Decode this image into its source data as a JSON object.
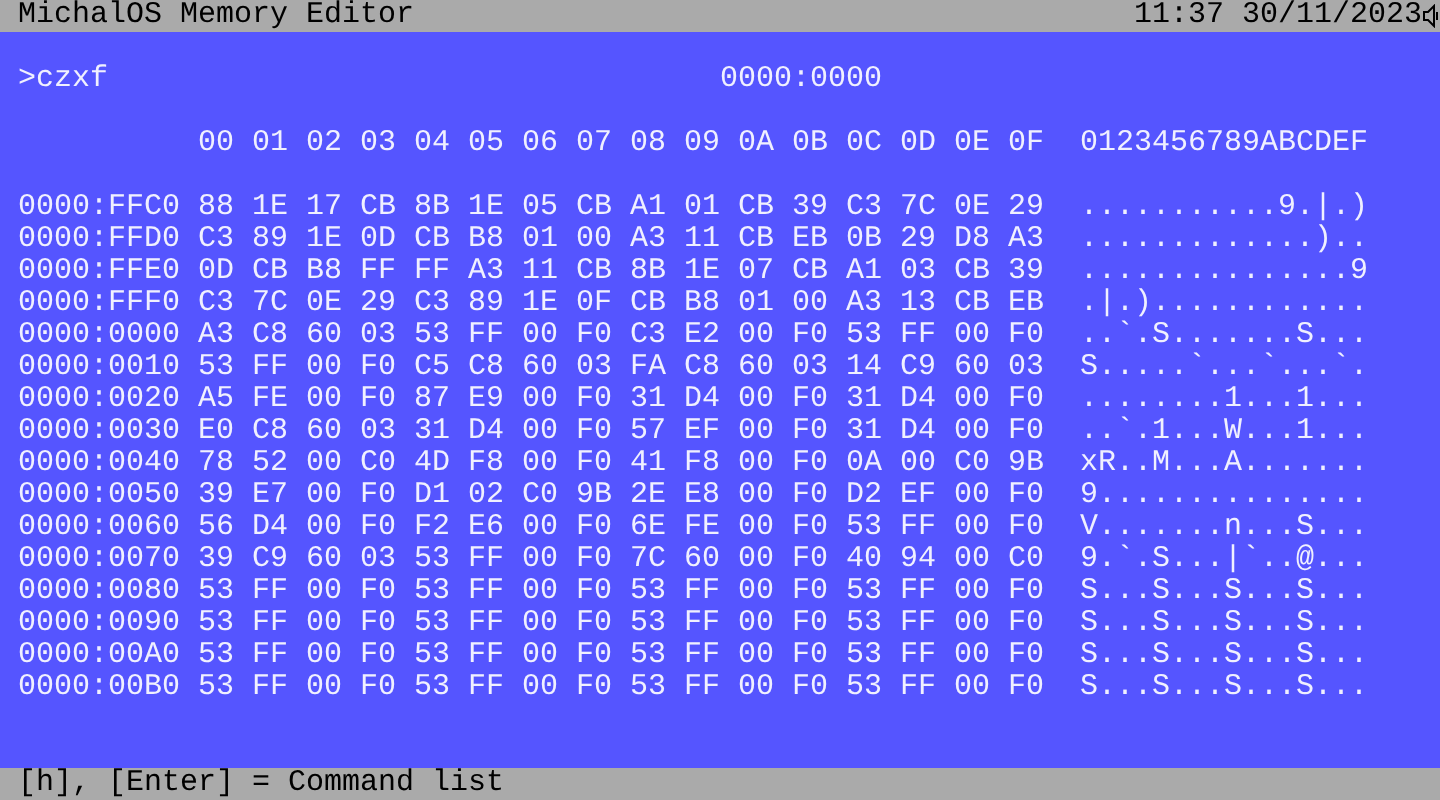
{
  "title_bar": {
    "title": "MichalOS Memory Editor",
    "clock": "11:37 30/11/2023"
  },
  "command": ">czxf",
  "address": "0000:0000",
  "column_headers": [
    "00",
    "01",
    "02",
    "03",
    "04",
    "05",
    "06",
    "07",
    "08",
    "09",
    "0A",
    "0B",
    "0C",
    "0D",
    "0E",
    "0F"
  ],
  "ascii_header": "0123456789ABCDEF",
  "rows": [
    {
      "address": "0000:FFC0",
      "bytes": [
        "88",
        "1E",
        "17",
        "CB",
        "8B",
        "1E",
        "05",
        "CB",
        "A1",
        "01",
        "CB",
        "39",
        "C3",
        "7C",
        "0E",
        "29"
      ],
      "ascii": "...........9.|.)"
    },
    {
      "address": "0000:FFD0",
      "bytes": [
        "C3",
        "89",
        "1E",
        "0D",
        "CB",
        "B8",
        "01",
        "00",
        "A3",
        "11",
        "CB",
        "EB",
        "0B",
        "29",
        "D8",
        "A3"
      ],
      "ascii": ".............).."
    },
    {
      "address": "0000:FFE0",
      "bytes": [
        "0D",
        "CB",
        "B8",
        "FF",
        "FF",
        "A3",
        "11",
        "CB",
        "8B",
        "1E",
        "07",
        "CB",
        "A1",
        "03",
        "CB",
        "39"
      ],
      "ascii": "...............9"
    },
    {
      "address": "0000:FFF0",
      "bytes": [
        "C3",
        "7C",
        "0E",
        "29",
        "C3",
        "89",
        "1E",
        "0F",
        "CB",
        "B8",
        "01",
        "00",
        "A3",
        "13",
        "CB",
        "EB"
      ],
      "ascii": ".|.)............"
    },
    {
      "address": "0000:0000",
      "bytes": [
        "A3",
        "C8",
        "60",
        "03",
        "53",
        "FF",
        "00",
        "F0",
        "C3",
        "E2",
        "00",
        "F0",
        "53",
        "FF",
        "00",
        "F0"
      ],
      "ascii": "..`.S.......S..."
    },
    {
      "address": "0000:0010",
      "bytes": [
        "53",
        "FF",
        "00",
        "F0",
        "C5",
        "C8",
        "60",
        "03",
        "FA",
        "C8",
        "60",
        "03",
        "14",
        "C9",
        "60",
        "03"
      ],
      "ascii": "S.....`...`...`."
    },
    {
      "address": "0000:0020",
      "bytes": [
        "A5",
        "FE",
        "00",
        "F0",
        "87",
        "E9",
        "00",
        "F0",
        "31",
        "D4",
        "00",
        "F0",
        "31",
        "D4",
        "00",
        "F0"
      ],
      "ascii": "........1...1..."
    },
    {
      "address": "0000:0030",
      "bytes": [
        "E0",
        "C8",
        "60",
        "03",
        "31",
        "D4",
        "00",
        "F0",
        "57",
        "EF",
        "00",
        "F0",
        "31",
        "D4",
        "00",
        "F0"
      ],
      "ascii": "..`.1...W...1..."
    },
    {
      "address": "0000:0040",
      "bytes": [
        "78",
        "52",
        "00",
        "C0",
        "4D",
        "F8",
        "00",
        "F0",
        "41",
        "F8",
        "00",
        "F0",
        "0A",
        "00",
        "C0",
        "9B"
      ],
      "ascii": "xR..M...A......."
    },
    {
      "address": "0000:0050",
      "bytes": [
        "39",
        "E7",
        "00",
        "F0",
        "D1",
        "02",
        "C0",
        "9B",
        "2E",
        "E8",
        "00",
        "F0",
        "D2",
        "EF",
        "00",
        "F0"
      ],
      "ascii": "9..............."
    },
    {
      "address": "0000:0060",
      "bytes": [
        "56",
        "D4",
        "00",
        "F0",
        "F2",
        "E6",
        "00",
        "F0",
        "6E",
        "FE",
        "00",
        "F0",
        "53",
        "FF",
        "00",
        "F0"
      ],
      "ascii": "V.......n...S..."
    },
    {
      "address": "0000:0070",
      "bytes": [
        "39",
        "C9",
        "60",
        "03",
        "53",
        "FF",
        "00",
        "F0",
        "7C",
        "60",
        "00",
        "F0",
        "40",
        "94",
        "00",
        "C0"
      ],
      "ascii": "9.`.S...|`..@..."
    },
    {
      "address": "0000:0080",
      "bytes": [
        "53",
        "FF",
        "00",
        "F0",
        "53",
        "FF",
        "00",
        "F0",
        "53",
        "FF",
        "00",
        "F0",
        "53",
        "FF",
        "00",
        "F0"
      ],
      "ascii": "S...S...S...S..."
    },
    {
      "address": "0000:0090",
      "bytes": [
        "53",
        "FF",
        "00",
        "F0",
        "53",
        "FF",
        "00",
        "F0",
        "53",
        "FF",
        "00",
        "F0",
        "53",
        "FF",
        "00",
        "F0"
      ],
      "ascii": "S...S...S...S..."
    },
    {
      "address": "0000:00A0",
      "bytes": [
        "53",
        "FF",
        "00",
        "F0",
        "53",
        "FF",
        "00",
        "F0",
        "53",
        "FF",
        "00",
        "F0",
        "53",
        "FF",
        "00",
        "F0"
      ],
      "ascii": "S...S...S...S..."
    },
    {
      "address": "0000:00B0",
      "bytes": [
        "53",
        "FF",
        "00",
        "F0",
        "53",
        "FF",
        "00",
        "F0",
        "53",
        "FF",
        "00",
        "F0",
        "53",
        "FF",
        "00",
        "F0"
      ],
      "ascii": "S...S...S...S..."
    }
  ],
  "status_bar": "[h], [Enter] = Command list"
}
